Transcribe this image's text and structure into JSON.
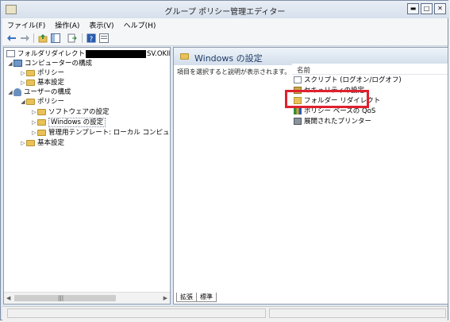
{
  "window": {
    "title": "グループ ポリシー管理エディター"
  },
  "window_controls": {
    "minimize": "▬",
    "restore": "□",
    "close": "✕"
  },
  "menu": [
    "ファイル(F)",
    "操作(A)",
    "表示(V)",
    "ヘルプ(H)"
  ],
  "tree": {
    "root_prefix": "フォルダリダイレクト",
    "root_suffix": "SV.OKINAWA.LO",
    "computer_config": "コンピューターの構成",
    "computer_policy": "ポリシー",
    "computer_prefs": "基本設定",
    "user_config": "ユーザーの構成",
    "user_policy": "ポリシー",
    "software_settings": "ソフトウェアの設定",
    "windows_settings": "Windows の設定",
    "admin_templates": "管理用テンプレート: ローカル コンピューターか",
    "user_prefs": "基本設定"
  },
  "right": {
    "header": "Windows の設定",
    "description": "項目を選択すると説明が表示されます。",
    "column_name": "名前",
    "items": [
      "スクリプト (ログオン/ログオフ)",
      "セキュリティの設定",
      "フォルダー リダイレクト",
      "ポリシー ベースの QoS",
      "展開されたプリンター"
    ]
  },
  "tabs": [
    "拡張",
    "標準"
  ],
  "colors": {
    "highlight_box": "#e0202e"
  }
}
